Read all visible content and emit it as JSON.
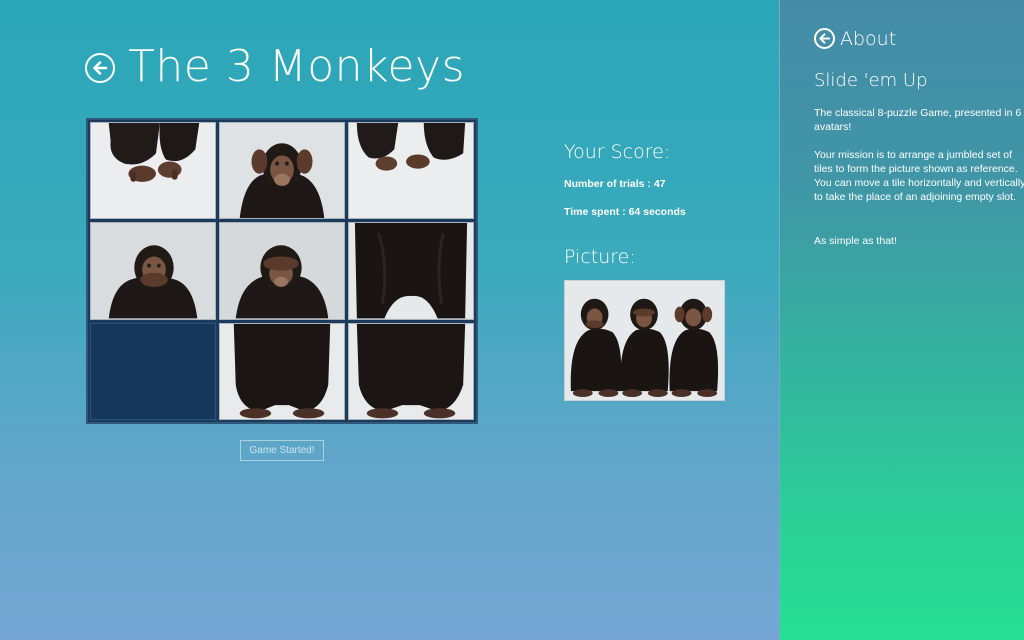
{
  "header": {
    "title": "The 3 Monkeys"
  },
  "board": {
    "status_button": "Game Started!",
    "tiles": [
      {
        "position": 1,
        "content": "hands"
      },
      {
        "position": 2,
        "content": "monkey-hear-no-evil"
      },
      {
        "position": 3,
        "content": "hands"
      },
      {
        "position": 4,
        "content": "monkey-speak-no-evil"
      },
      {
        "position": 5,
        "content": "monkey-see-no-evil"
      },
      {
        "position": 6,
        "content": "fur"
      },
      {
        "position": 7,
        "content": "empty"
      },
      {
        "position": 8,
        "content": "body"
      },
      {
        "position": 9,
        "content": "body"
      }
    ]
  },
  "score": {
    "title": "Your Score:",
    "trials": "Number of trials : 47",
    "time": "Time spent : 64 seconds"
  },
  "picture": {
    "title": "Picture:"
  },
  "about": {
    "title": "About",
    "heading": "Slide 'em Up",
    "p1": "The classical 8-puzzle Game, presented in 6 avatars!",
    "p2": "Your mission is to arrange a jumbled set of tiles to form the picture shown as reference. You can move a tile horizontally and vertically to take the place of an adjoining empty slot.",
    "p3": "As simple as that!"
  },
  "colors": {
    "main_gradient_top": "#2aa6b8",
    "main_gradient_bottom": "#76a7d4",
    "side_gradient_top": "#458ba8",
    "side_gradient_bottom": "#27df95",
    "board_bg": "#1b3a5c",
    "empty_tile": "#15375a"
  }
}
